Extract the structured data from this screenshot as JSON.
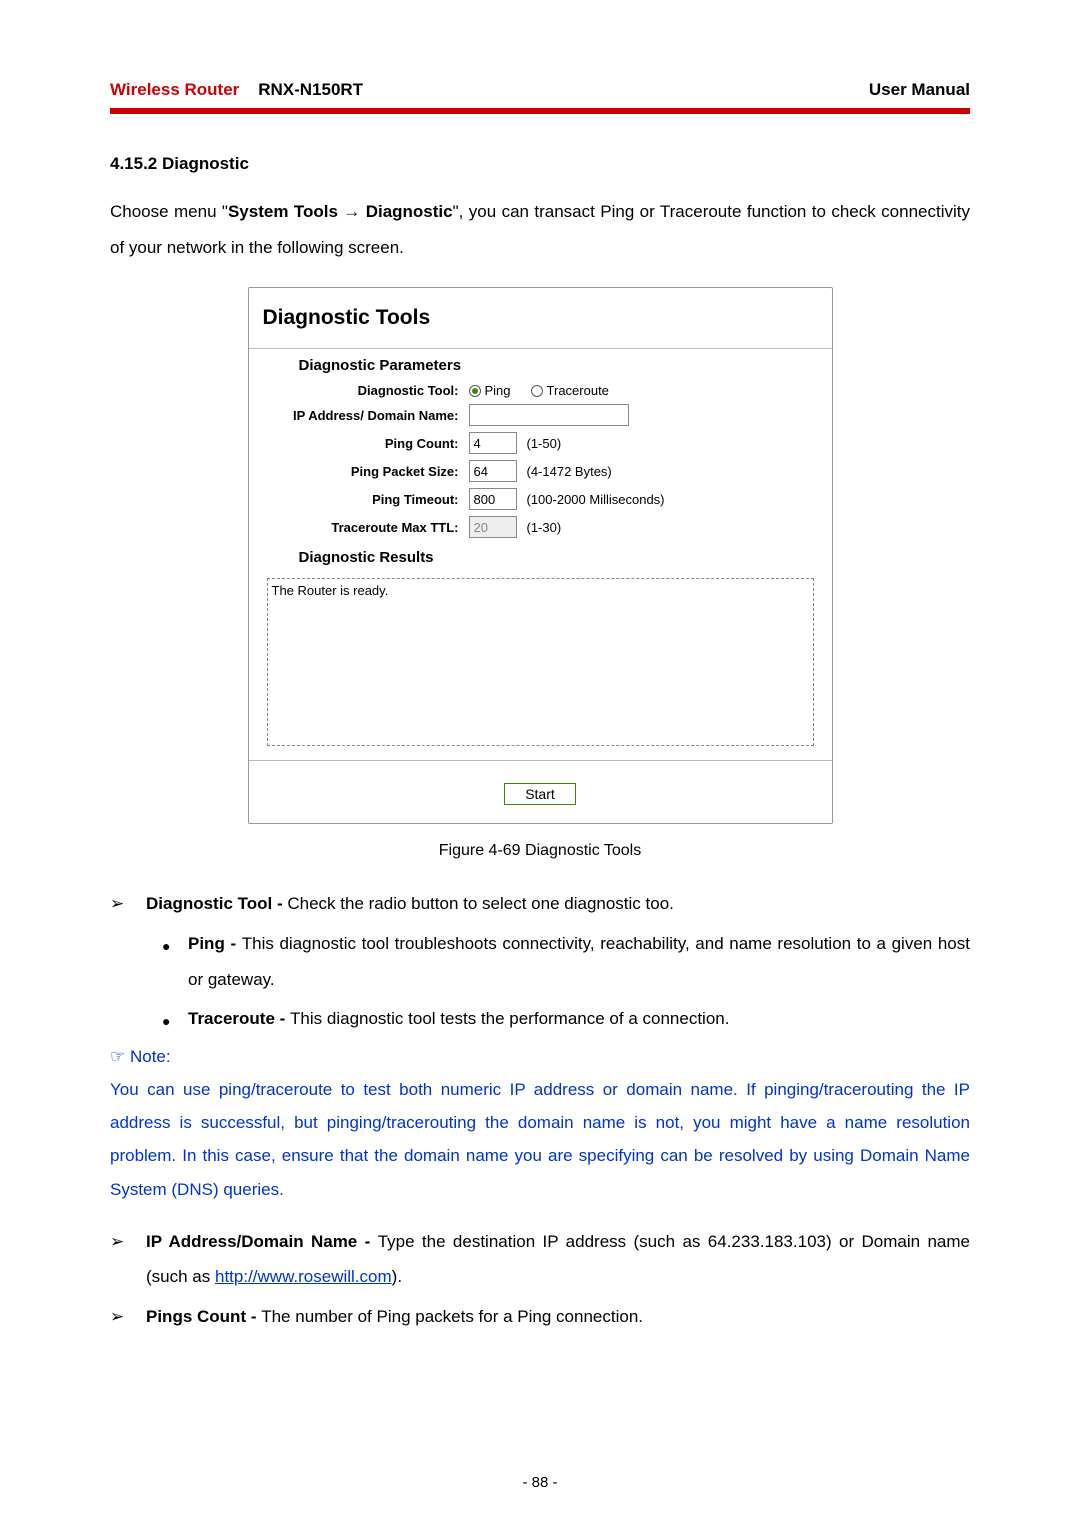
{
  "header": {
    "brand": "Wireless Router",
    "model": "RNX-N150RT",
    "manual": "User Manual"
  },
  "section": {
    "number": "4.15.2",
    "title": "Diagnostic"
  },
  "intro": {
    "pre": "Choose menu \"",
    "menu1": "System Tools",
    "arrow": " → ",
    "menu2": "Diagnostic",
    "post": "\", you can transact Ping or Traceroute function to check connectivity of your network in the following screen."
  },
  "panel": {
    "title": "Diagnostic Tools",
    "params_title": "Diagnostic Parameters",
    "rows": {
      "tool_label": "Diagnostic Tool:",
      "ping_label": "Ping",
      "traceroute_label": "Traceroute",
      "ip_label": "IP Address/ Domain Name:",
      "ip_value": "",
      "ping_count_label": "Ping Count:",
      "ping_count_value": "4",
      "ping_count_hint": "(1-50)",
      "ping_pkt_label": "Ping Packet Size:",
      "ping_pkt_value": "64",
      "ping_pkt_hint": "(4-1472 Bytes)",
      "ping_timeout_label": "Ping Timeout:",
      "ping_timeout_value": "800",
      "ping_timeout_hint": "(100-2000 Milliseconds)",
      "trace_ttl_label": "Traceroute Max TTL:",
      "trace_ttl_value": "20",
      "trace_ttl_hint": "(1-30)"
    },
    "results_title": "Diagnostic Results",
    "results_text": "The Router is ready.",
    "start_label": "Start"
  },
  "figure_caption": "Figure 4-69    Diagnostic Tools",
  "bullets": {
    "diag_tool_b": "Diagnostic Tool - ",
    "diag_tool_t": "Check the radio button to select one diagnostic too.",
    "ping_b": "Ping - ",
    "ping_t": "This diagnostic tool troubleshoots connectivity, reachability, and name resolution to a given host or gateway.",
    "trace_b": "Traceroute - ",
    "trace_t": "This diagnostic tool tests the performance of a connection.",
    "ip_b": "IP Address/Domain Name - ",
    "ip_t1": "Type the destination IP address (such as 64.233.183.103) or Domain name (such as ",
    "ip_link": "http://www.rosewill.com",
    "ip_t2": ").",
    "pings_b": "Pings Count - ",
    "pings_t": "The number of Ping packets for a Ping connection."
  },
  "note": {
    "head": "☞ Note:",
    "body": "You can use ping/traceroute to test both numeric IP address or domain name. If pinging/tracerouting the IP address is successful, but pinging/tracerouting the domain name is not, you might have a name resolution problem. In this case, ensure that the domain name you are specifying can be resolved by using Domain Name System (DNS) queries."
  },
  "page_number": "- 88 -",
  "chart_data": {
    "type": "table",
    "title": "Diagnostic Parameters",
    "rows": [
      {
        "label": "Diagnostic Tool",
        "value": "Ping",
        "options": [
          "Ping",
          "Traceroute"
        ]
      },
      {
        "label": "IP Address/ Domain Name",
        "value": ""
      },
      {
        "label": "Ping Count",
        "value": 4,
        "range": "1-50"
      },
      {
        "label": "Ping Packet Size",
        "value": 64,
        "range": "4-1472 Bytes"
      },
      {
        "label": "Ping Timeout",
        "value": 800,
        "range": "100-2000 Milliseconds"
      },
      {
        "label": "Traceroute Max TTL",
        "value": 20,
        "range": "1-30"
      }
    ],
    "results": "The Router is ready."
  }
}
